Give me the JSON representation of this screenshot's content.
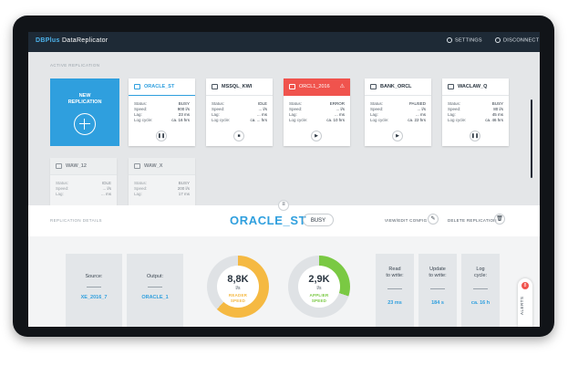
{
  "app": {
    "brand": "DBPlus",
    "title": "DataReplicator"
  },
  "topbar": {
    "settings": "SETTINGS",
    "disconnect": "DISCONNECT"
  },
  "section": {
    "active_replication": "ACTIVE REPLICATION"
  },
  "new_card": {
    "line1": "NEW",
    "line2": "REPLICATION"
  },
  "cards": [
    {
      "name": "ORACLE_ST",
      "status": "BUSY",
      "speed": "900 l/s",
      "lag": "23 ms",
      "log_cycle": "ca. 16 hrs",
      "control": "pause"
    },
    {
      "name": "MSSQL_KWI",
      "status": "IDLE",
      "speed": "... l/s",
      "lag": "... ms",
      "log_cycle": "ca. ... hrs",
      "control": "stop"
    },
    {
      "name": "ORCL1_2016",
      "status": "ERROR",
      "speed": "... l/s",
      "lag": "... ms",
      "log_cycle": "ca. 10 hrs",
      "control": "play"
    },
    {
      "name": "BANK_ORCL",
      "status": "PAUSED",
      "speed": "... l/s",
      "lag": "... ms",
      "log_cycle": "ca. 22 hrs",
      "control": "play"
    },
    {
      "name": "WACLAW_Q",
      "status": "BUSY",
      "speed": "80 l/s",
      "lag": "45 ms",
      "log_cycle": "ca. 46 hrs",
      "control": "pause"
    },
    {
      "name": "WAW_12",
      "status": "IDLE",
      "speed": "... l/s",
      "lag": "... ms"
    },
    {
      "name": "WAW_X",
      "status": "BUSY",
      "speed": "200 l/s",
      "lag": "17 ms"
    }
  ],
  "labels": {
    "status": "Status:",
    "speed": "Speed:",
    "lag": "Lag:",
    "log_cycle": "Log cycle:"
  },
  "details": {
    "label": "REPLICATION DETAILS",
    "name": "ORACLE_ST",
    "status": "BUSY",
    "view_edit": "VIEW/EDIT CONFIG",
    "delete": "DELETE REPLICATION"
  },
  "source": {
    "label": "Source:",
    "value": "XE_2016_7"
  },
  "output": {
    "label": "Output:",
    "value": "ORACLE_1"
  },
  "reader": {
    "value": "8,8K",
    "unit": "l/s",
    "caption1": "READER",
    "caption2": "SPEED",
    "fraction": 0.62,
    "color": "#f5b942"
  },
  "applier": {
    "value": "2,9K",
    "unit": "l/s",
    "caption1": "APPLIER",
    "caption2": "SPEED",
    "fraction": 0.3,
    "color": "#7ac943"
  },
  "metrics": [
    {
      "line1": "Read",
      "line2": "to write:",
      "value": "23 ms"
    },
    {
      "line1": "Update",
      "line2": "to write:",
      "value": "184 s"
    },
    {
      "line1": "Log",
      "line2": "cycle:",
      "value": "ca. 16 h"
    }
  ],
  "alerts": {
    "label": "ALERTS",
    "count": "8"
  },
  "colors": {
    "accent": "#2f9fde",
    "error": "#f0534d",
    "topbar": "#1e2a36"
  }
}
